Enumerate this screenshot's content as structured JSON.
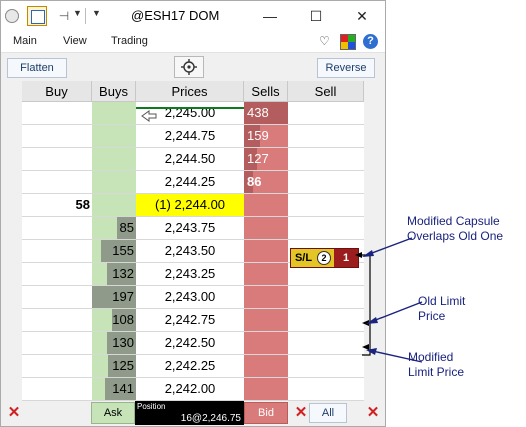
{
  "window": {
    "title": "@ESH17 DOM",
    "minimize_glyph": "—",
    "maximize_glyph": "☐",
    "close_glyph": "✕"
  },
  "menu": {
    "items": [
      "Main",
      "View",
      "Trading"
    ],
    "help_glyph": "?"
  },
  "toolbar": {
    "flatten_label": "Flatten",
    "reverse_label": "Reverse",
    "crosshair_icon": "crosshair-icon"
  },
  "headers": {
    "buy": "Buy",
    "buys": "Buys",
    "prices": "Prices",
    "sells": "Sells",
    "sell": "Sell"
  },
  "ladder": [
    {
      "buy": "",
      "buys": "",
      "price": "2,245.00",
      "sells": "438",
      "sell": ""
    },
    {
      "buy": "",
      "buys": "",
      "price": "2,244.75",
      "sells": "159",
      "sell": ""
    },
    {
      "buy": "",
      "buys": "",
      "price": "2,244.50",
      "sells": "127",
      "sell": ""
    },
    {
      "buy": "",
      "buys": "",
      "price": "2,244.25",
      "sells": "86",
      "sell": ""
    },
    {
      "buy": "58",
      "buys": "",
      "price": "(1) 2,244.00",
      "sells": "",
      "sell": ""
    },
    {
      "buy": "",
      "buys": "85",
      "price": "2,243.75",
      "sells": "",
      "sell": ""
    },
    {
      "buy": "",
      "buys": "155",
      "price": "2,243.50",
      "sells": "",
      "sell": ""
    },
    {
      "buy": "",
      "buys": "132",
      "price": "2,243.25",
      "sells": "",
      "sell": ""
    },
    {
      "buy": "",
      "buys": "197",
      "price": "2,243.00",
      "sells": "",
      "sell": ""
    },
    {
      "buy": "",
      "buys": "108",
      "price": "2,242.75",
      "sells": "",
      "sell": ""
    },
    {
      "buy": "",
      "buys": "130",
      "price": "2,242.50",
      "sells": "",
      "sell": ""
    },
    {
      "buy": "",
      "buys": "125",
      "price": "2,242.25",
      "sells": "",
      "sell": ""
    },
    {
      "buy": "",
      "buys": "141",
      "price": "2,242.00",
      "sells": "",
      "sell": ""
    }
  ],
  "capsule": {
    "sl_label": "S/L",
    "order_count": "2",
    "quantity": "1"
  },
  "bottom": {
    "ask_label": "Ask",
    "position_label": "Position",
    "position_value": "16@2,246.75",
    "bid_label": "Bid",
    "all_label": "All",
    "close_glyph": "✕"
  },
  "annotations": {
    "modified_capsule": [
      "Modified Capsule",
      "Overlaps Old One"
    ],
    "old_limit_price": [
      "Old Limit",
      "Price"
    ],
    "modified_limit_price": [
      "Modified",
      "Limit Price"
    ]
  },
  "colors": {
    "buys_bg": "#c6e4b8",
    "sells_bg": "#d97b7b",
    "highlight": "#ffff00",
    "annotation": "#1a237e"
  }
}
